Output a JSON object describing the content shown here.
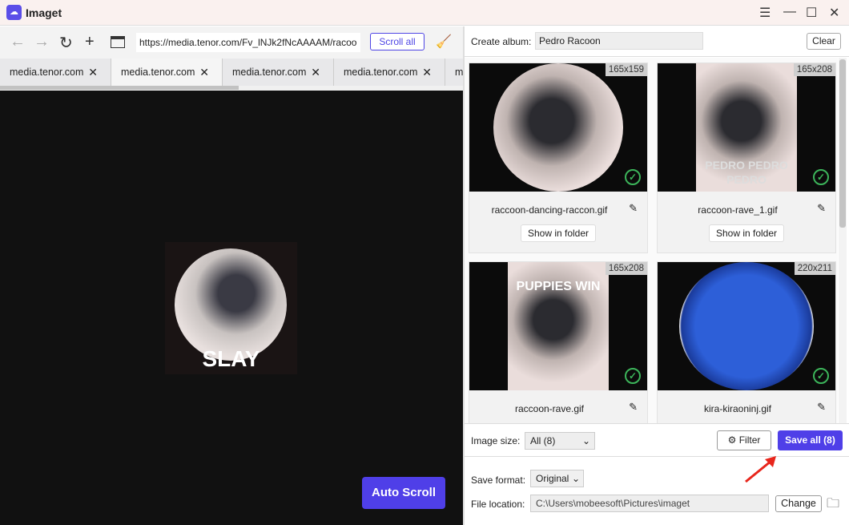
{
  "app": {
    "title": "Imaget",
    "logo": "cloud-logo"
  },
  "window_controls": {
    "menu": "☰",
    "minimize": "—",
    "maximize": "☐",
    "close": "✕"
  },
  "browser": {
    "url": "https://media.tenor.com/Fv_lNJk2fNcAAAAM/racoo",
    "scroll_all_label": "Scroll all",
    "tabs": [
      {
        "label": "media.tenor.com",
        "active": false
      },
      {
        "label": "media.tenor.com",
        "active": true
      },
      {
        "label": "media.tenor.com",
        "active": false
      },
      {
        "label": "media.tenor.com",
        "active": false
      },
      {
        "label": "m",
        "active": false
      }
    ],
    "viewer_caption": "SLAY",
    "auto_scroll_label": "Auto Scroll"
  },
  "album": {
    "label": "Create album:",
    "value": "Pedro Racoon",
    "clear_label": "Clear"
  },
  "images": [
    {
      "dims": "165x159",
      "filename": "raccoon-dancing-raccon.gif",
      "caption": "",
      "show_in_folder": "Show in folder",
      "checked": true
    },
    {
      "dims": "165x208",
      "filename": "raccoon-rave_1.gif",
      "caption": "PEDRO PEDRO PEDRO",
      "show_in_folder": "Show in folder",
      "checked": true
    },
    {
      "dims": "165x208",
      "filename": "raccoon-rave.gif",
      "caption": "PUPPIES WIN",
      "checked": true
    },
    {
      "dims": "220x211",
      "filename": "kira-kiraoninj.gif",
      "caption": "",
      "checked": true
    }
  ],
  "controls": {
    "image_size_label": "Image size:",
    "image_size_value": "All (8)",
    "filter_label": "Filter",
    "save_all_label": "Save all (8)",
    "save_format_label": "Save format:",
    "save_format_value": "Original",
    "file_location_label": "File location:",
    "file_location_value": "C:\\Users\\mobeesoft\\Pictures\\imaget",
    "change_label": "Change"
  },
  "colors": {
    "accent": "#4f3fe8",
    "check": "#3cb45a",
    "annotation_arrow": "#e8261c"
  }
}
